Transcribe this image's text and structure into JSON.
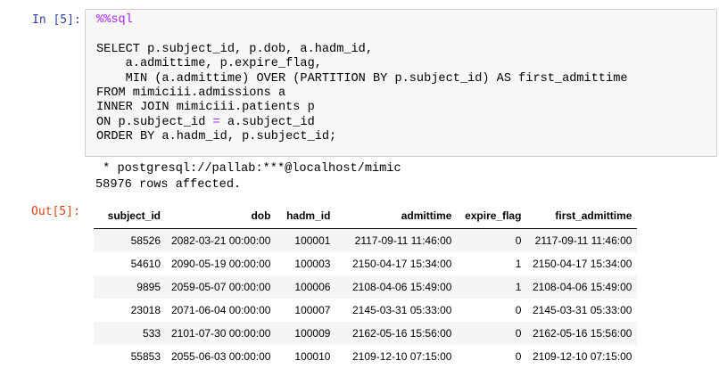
{
  "input_prompt": "In [5]:",
  "output_prompt": "Out[5]:",
  "code": {
    "magic": "%%sql",
    "line_select": "SELECT p.subject_id, p.dob, a.hadm_id,",
    "line_cols": "    a.admittime, p.expire_flag,",
    "line_min": "    MIN (a.admittime) OVER (PARTITION BY p.subject_id) AS first_admittime",
    "line_from": "FROM mimiciii.admissions a",
    "line_join": "INNER JOIN mimiciii.patients p",
    "line_on_left": "ON p.subject_id ",
    "line_on_op": "=",
    "line_on_right": " a.subject_id",
    "line_order": "ORDER BY a.hadm_id, p.subject_id;"
  },
  "stdout": {
    "connection": " * postgresql://pallab:***@localhost/mimic",
    "rows_affected": "58976 rows affected."
  },
  "table": {
    "columns": [
      "subject_id",
      "dob",
      "hadm_id",
      "admittime",
      "expire_flag",
      "first_admittime"
    ],
    "rows": [
      [
        "58526",
        "2082-03-21 00:00:00",
        "100001",
        "2117-09-11 11:46:00",
        "0",
        "2117-09-11 11:46:00"
      ],
      [
        "54610",
        "2090-05-19 00:00:00",
        "100003",
        "2150-04-17 15:34:00",
        "1",
        "2150-04-17 15:34:00"
      ],
      [
        "9895",
        "2059-05-07 00:00:00",
        "100006",
        "2108-04-06 15:49:00",
        "1",
        "2108-04-06 15:49:00"
      ],
      [
        "23018",
        "2071-06-04 00:00:00",
        "100007",
        "2145-03-31 05:33:00",
        "0",
        "2145-03-31 05:33:00"
      ],
      [
        "533",
        "2101-07-30 00:00:00",
        "100009",
        "2162-05-16 15:56:00",
        "0",
        "2162-05-16 15:56:00"
      ],
      [
        "55853",
        "2055-06-03 00:00:00",
        "100010",
        "2109-12-10 07:15:00",
        "0",
        "2109-12-10 07:15:00"
      ]
    ]
  },
  "colors": {
    "input_prompt": "#303f9f",
    "output_prompt": "#d84315",
    "magic": "#aa22ff",
    "cell_background": "#f7f7f7",
    "cell_border": "#cfcfcf",
    "stripe": "#f5f5f5"
  }
}
